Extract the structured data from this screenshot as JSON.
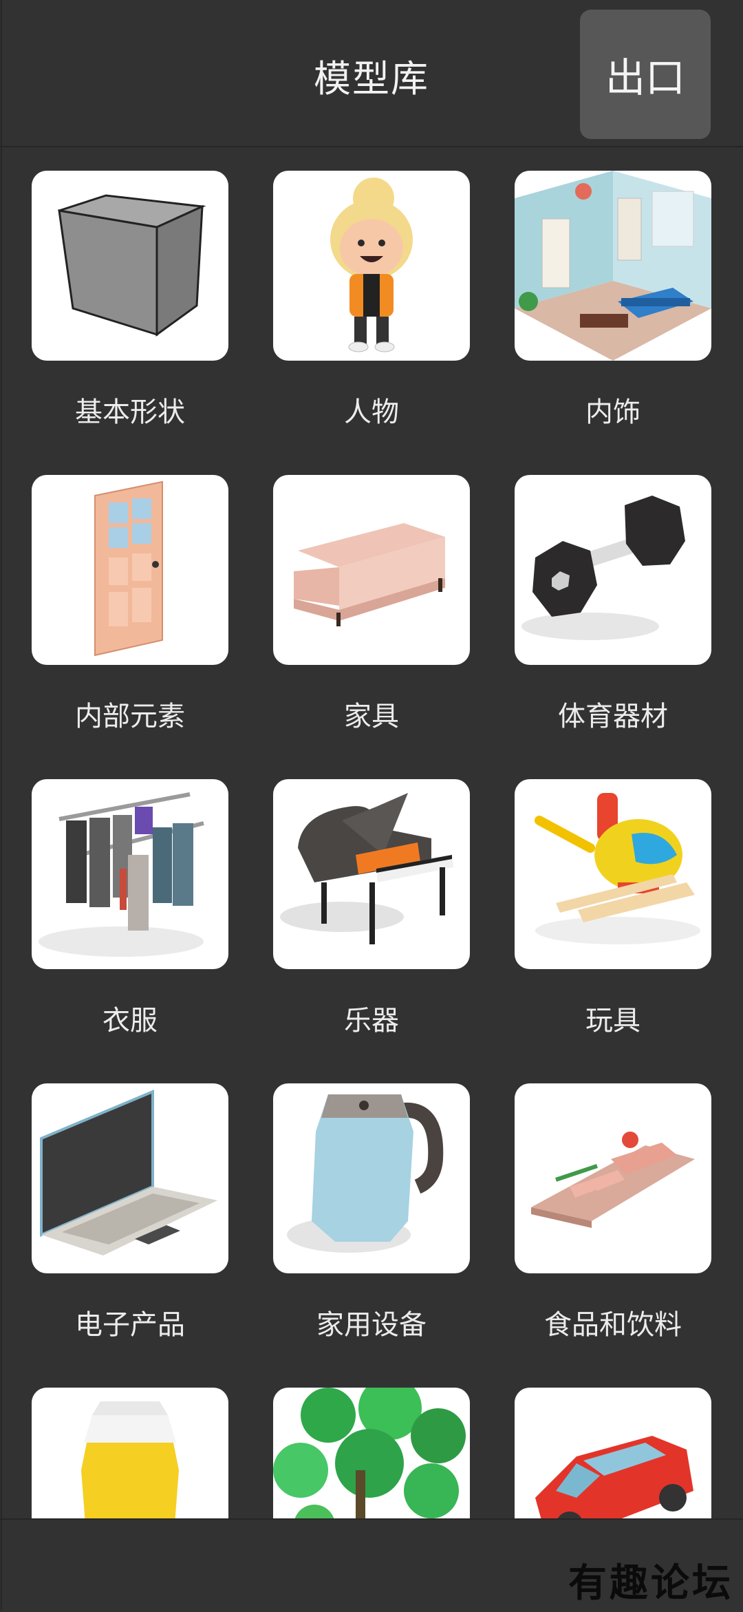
{
  "header": {
    "title": "模型库",
    "exit_label": "出口"
  },
  "categories": [
    {
      "label": "基本形状",
      "icon": "cube-icon"
    },
    {
      "label": "人物",
      "icon": "character-icon"
    },
    {
      "label": "内饰",
      "icon": "room-interior-icon"
    },
    {
      "label": "内部元素",
      "icon": "door-icon"
    },
    {
      "label": "家具",
      "icon": "sofa-icon"
    },
    {
      "label": "体育器材",
      "icon": "dumbbell-icon"
    },
    {
      "label": "衣服",
      "icon": "clothes-rack-icon"
    },
    {
      "label": "乐器",
      "icon": "piano-icon"
    },
    {
      "label": "玩具",
      "icon": "toy-helicopter-icon"
    },
    {
      "label": "电子产品",
      "icon": "laptop-icon"
    },
    {
      "label": "家用设备",
      "icon": "kettle-icon"
    },
    {
      "label": "食品和饮料",
      "icon": "food-board-icon"
    },
    {
      "icon": "beer-glass-icon"
    },
    {
      "icon": "plants-icon"
    },
    {
      "icon": "car-icon"
    }
  ],
  "watermark": "有趣论坛"
}
